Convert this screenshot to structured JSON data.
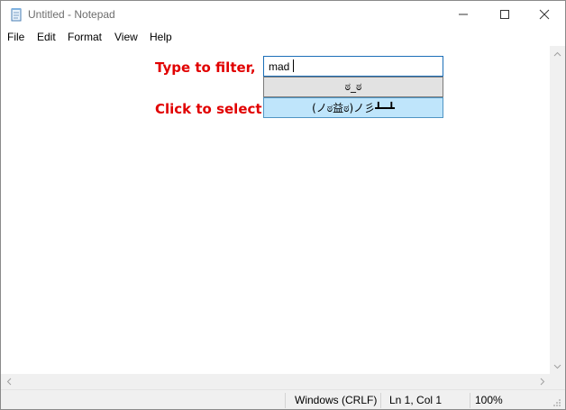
{
  "window": {
    "title": "Untitled - Notepad"
  },
  "menu": [
    "File",
    "Edit",
    "Format",
    "View",
    "Help"
  ],
  "editor": {
    "filter_label": "Type to filter,",
    "select_label": "Click to select:",
    "filter_value": "mad",
    "results": [
      "ಠ_ಠ",
      "(ノಠ益ಠ)ノ彡┻━┻"
    ]
  },
  "status": {
    "line_endings": "Windows (CRLF)",
    "position": "Ln 1, Col 1",
    "zoom": "100%"
  },
  "colors": {
    "label_red": "#e10000",
    "selected_bg": "#bfe5fb",
    "input_border": "#1c6fb8"
  }
}
